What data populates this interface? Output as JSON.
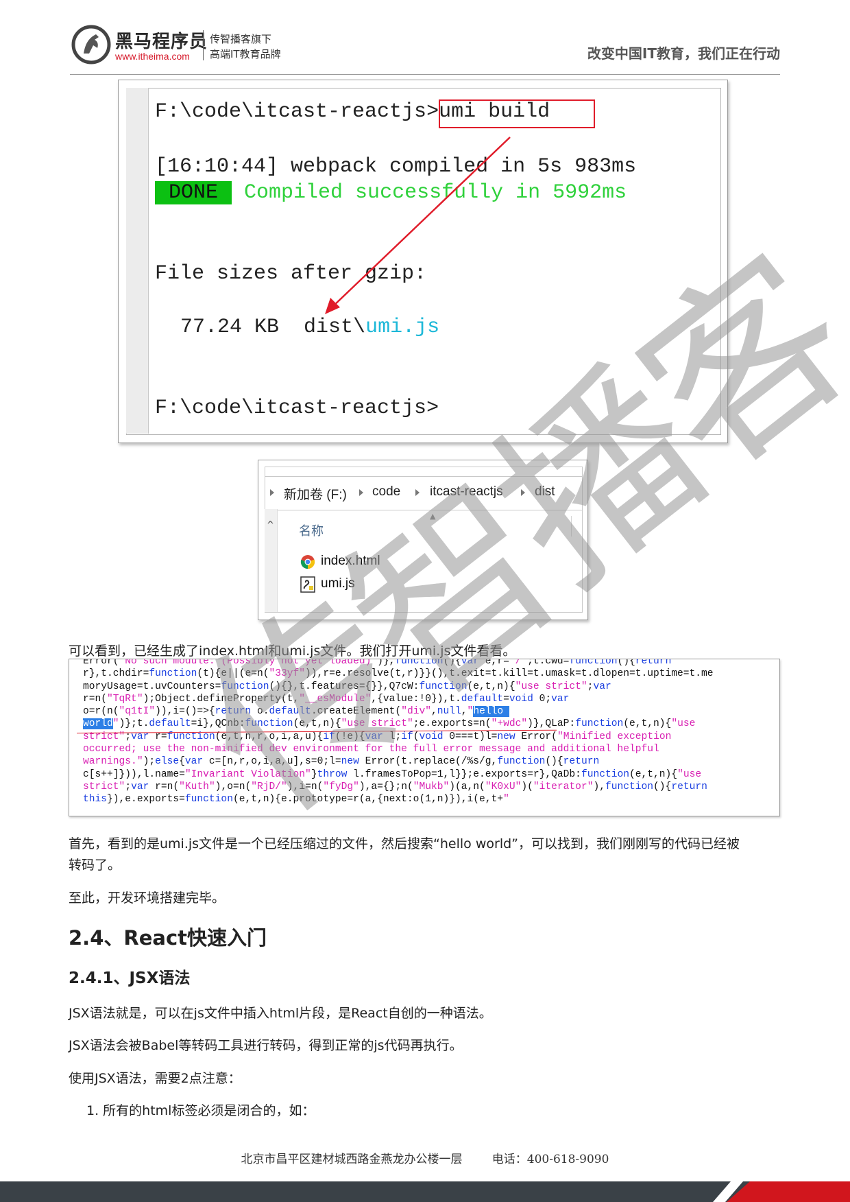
{
  "header": {
    "brand_name": "黑马程序员",
    "brand_url": "www.itheima.com",
    "tagline_line1": "传智播客旗下",
    "tagline_line2": "高端IT教育品牌",
    "slogan": "改变中国IT教育，我们正在行动"
  },
  "terminal": {
    "line1_prefix": "F:\\code\\itcast-reactjs>",
    "line1_command": "umi build",
    "line2": "[16:10:44] webpack compiled in 5s 983ms",
    "done_badge": "DONE",
    "done_message": "Compiled successfully in 5992ms",
    "sizes_heading": "File sizes after gzip:",
    "size_value": "77.24 KB",
    "size_path_prefix": "dist\\",
    "size_path_file": "umi.js",
    "last_prompt": "F:\\code\\itcast-reactjs>"
  },
  "explorer": {
    "breadcrumb": [
      "新加卷 (F:)",
      "code",
      "itcast-reactjs",
      "dist"
    ],
    "column_header": "名称",
    "files": [
      {
        "name": "index.html",
        "icon": "chrome-html-icon"
      },
      {
        "name": "umi.js",
        "icon": "js-file-icon"
      }
    ]
  },
  "paragraphs": {
    "p1": "可以看到，已经生成了index.html和umi.js文件。我们打开umi.js文件看看。",
    "p2_line1": "首先，看到的是umi.js文件是一个已经压缩过的文件，然后搜索“hello world”，可以找到，我们刚刚写的代码已经被",
    "p2_line2": "转码了。",
    "p3": "至此，开发环境搭建完毕。",
    "h2": "2.4、React快速入门",
    "h3": "2.4.1、JSX语法",
    "p4": "JSX语法就是，可以在js文件中插入html片段，是React自创的一种语法。",
    "p5": "JSX语法会被Babel等转码工具进行转码，得到正常的js代码再执行。",
    "p6": "使用JSX语法，需要2点注意：",
    "list_item_1": "1. 所有的html标签必须是闭合的，如："
  },
  "code": {
    "l0a": "Error(",
    "l0b": "\"No such module: (Possibly not yet loaded)\"",
    "l0c": ")},",
    "l0d": "function",
    "l0e": "(){",
    "l0f": "var",
    "l0g": " e,r=",
    "l0h": "\"/\"",
    "l0i": ";t.cwd=",
    "l0j": "function",
    "l0k": "(){",
    "l0l": "return",
    "l1a": "r},t.chdir=",
    "l1b": "function",
    "l1c": "(t){e||(e=n(",
    "l1d": "\"33yf\"",
    "l1e": ")),r=e.resolve(t,r)}}(),t.exit=t.kill=t.umask=t.dlopen=t.uptime=t.me",
    "l2a": "moryUsage=t.uvCounters=",
    "l2b": "function",
    "l2c": "(){},t.features={}},Q7cW:",
    "l2d": "function",
    "l2e": "(e,t,n){",
    "l2f": "\"use strict\"",
    "l2g": ";",
    "l2h": "var",
    "l3a": "r=n(",
    "l3b": "\"TqRt\"",
    "l3c": ");Object.defineProperty(t,",
    "l3d": "\"__esModule\"",
    "l3e": ",{value:!0}),t.",
    "l3f": "default",
    "l3g": "=",
    "l3h": "void",
    "l3i": " 0;",
    "l3j": "var",
    "l4a": "o=r(n(",
    "l4b": "\"q1tI\"",
    "l4c": ")),i=()=>{",
    "l4d": "return",
    "l4e": " o.",
    "l4f": "default",
    "l4g": ".createElement(",
    "l4h": "\"div\"",
    "l4i": ",",
    "l4j": "null",
    "l4k": ",",
    "l4l": "\"",
    "l4m": "hello ",
    "l5a": "world",
    "l5b": "\"",
    "l5c": ")};t.",
    "l5d": "default",
    "l5e": "=i},QCnb:",
    "l5f": "function",
    "l5g": "(e,t,n){",
    "l5h": "\"use strict\"",
    "l5i": ";e.exports=n(",
    "l5j": "\"+wdc\"",
    "l5k": ")},QLaP:",
    "l5l": "function",
    "l5m": "(e,t,n){",
    "l5n": "\"use",
    "l6a": "strict\"",
    "l6b": ";",
    "l6c": "var",
    "l6d": " r=",
    "l6e": "function",
    "l6f": "(e,t,n,r,o,i,a,u){",
    "l6g": "if",
    "l6h": "(!e){",
    "l6i": "var",
    "l6j": " l;",
    "l6k": "if",
    "l6l": "(",
    "l6m": "void",
    "l6n": " 0===t)l=",
    "l6o": "new",
    "l6p": " Error(",
    "l6q": "\"Minified exception",
    "l7a": "occurred; use the non-minified dev environment for the full error message and additional helpful",
    "l8a": "warnings.\"",
    "l8b": ");",
    "l8c": "else",
    "l8d": "{",
    "l8e": "var",
    "l8f": " c=[n,r,o,i,a,u],s=0;l=",
    "l8g": "new",
    "l8h": " Error(t.replace(/%s/g,",
    "l8i": "function",
    "l8j": "(){",
    "l8k": "return",
    "l9a": "c[s++]})),l.name=",
    "l9b": "\"Invariant Violation\"",
    "l9c": "}",
    "l9d": "throw",
    "l9e": " l.framesToPop=1,l}};e.exports=r},QaDb:",
    "l9f": "function",
    "l9g": "(e,t,n){",
    "l9h": "\"use",
    "l10a": "strict\"",
    "l10b": ";",
    "l10c": "var",
    "l10d": " r=n(",
    "l10e": "\"Kuth\"",
    "l10f": "),o=n(",
    "l10g": "\"RjD/\"",
    "l10h": "),i=n(",
    "l10i": "\"fyDg\"",
    "l10j": "),a={};n(",
    "l10k": "\"Mukb\"",
    "l10l": ")(a,n(",
    "l10m": "\"K0xU\"",
    "l10n": ")(",
    "l10o": "\"iterator\"",
    "l10p": "),",
    "l10q": "function",
    "l10r": "(){",
    "l10s": "return",
    "l11a": "this",
    "l11b": "}),e.exports=",
    "l11c": "function",
    "l11d": "(e,t,n){e.prototype=r(a,{next:o(1,n)}),i(e,t+",
    "l11e": "\""
  },
  "watermark": "传智播客",
  "footer": {
    "address": "北京市昌平区建材城西路金燕龙办公楼一层",
    "phone": "电话：400-618-9090"
  },
  "colors": {
    "accent_red": "#d1161d",
    "done_green": "#0cc012",
    "success_text": "#2fd13b",
    "path_cyan": "#1db8d8",
    "code_string": "#d81fb2",
    "code_keyword": "#1a3ee0",
    "footer_dark": "#3a4147"
  }
}
